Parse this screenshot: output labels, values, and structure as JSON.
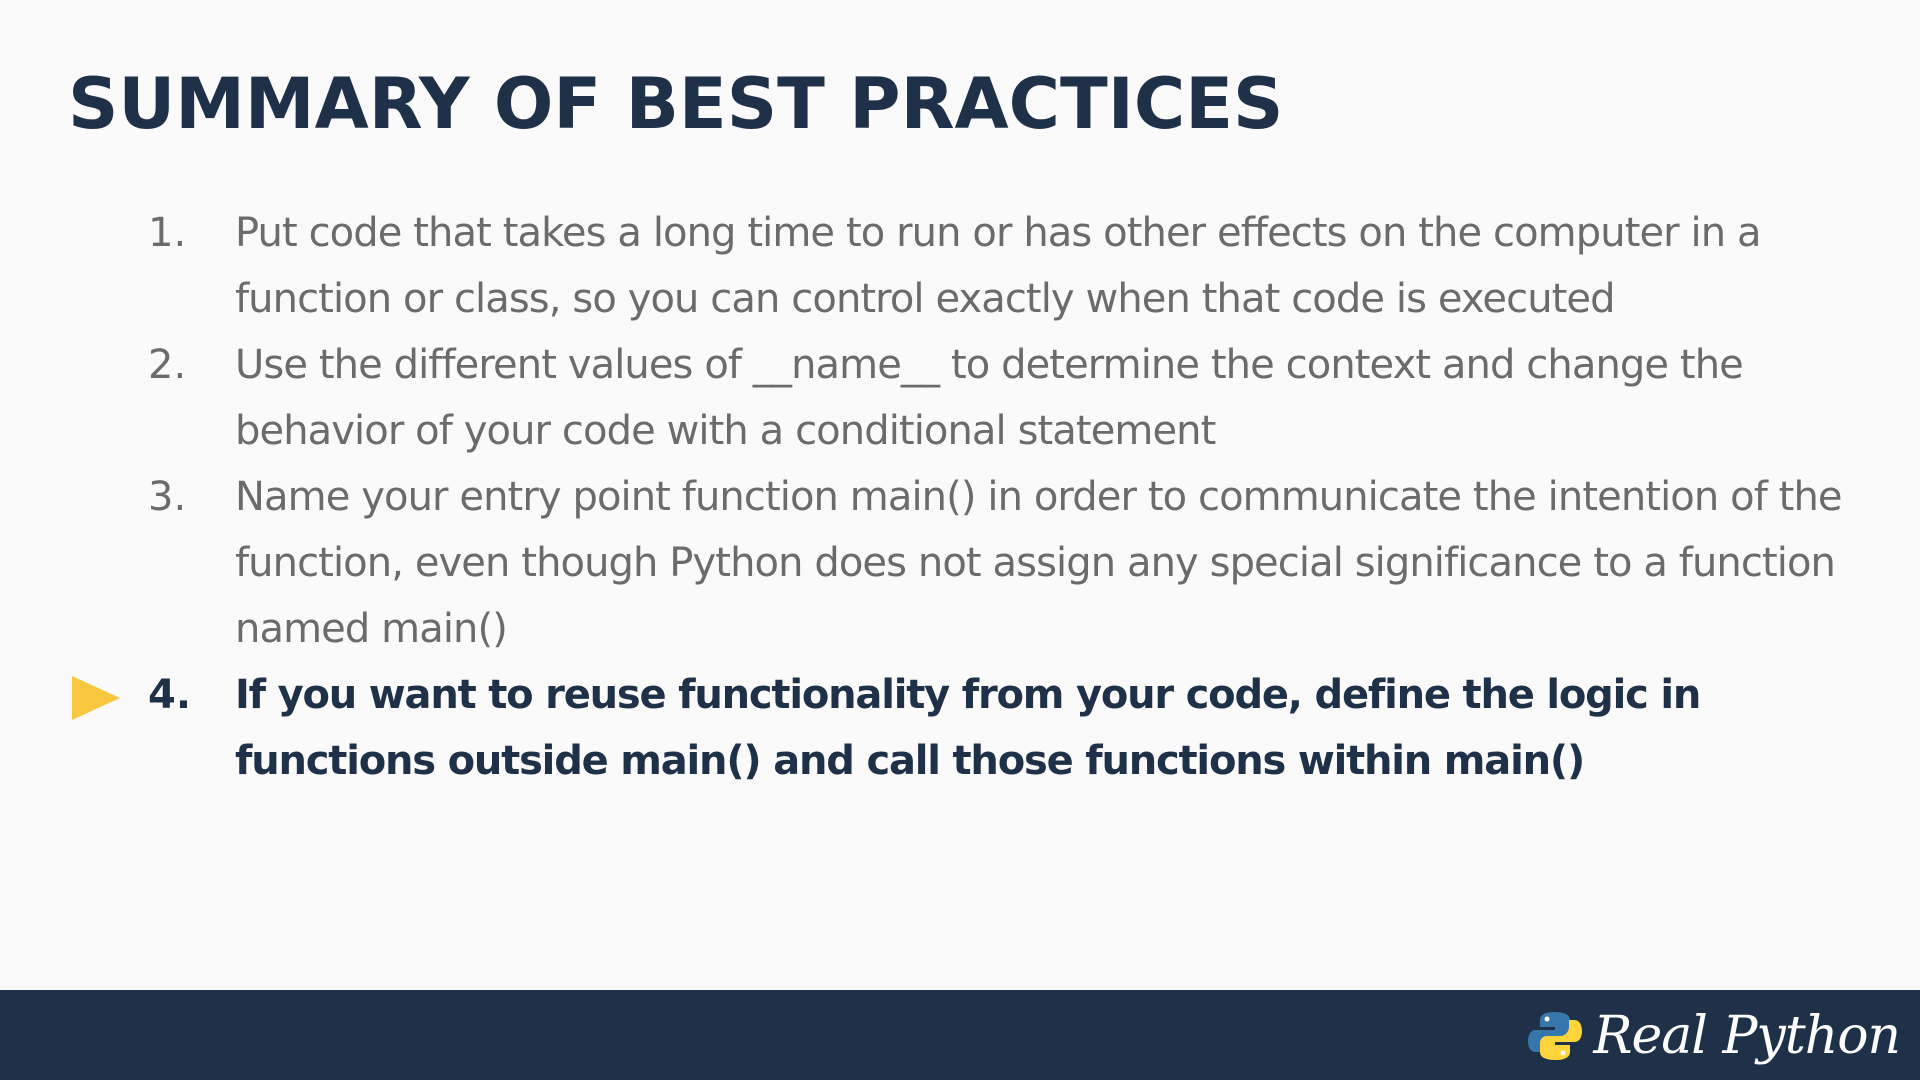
{
  "slide": {
    "title": "SUMMARY OF BEST PRACTICES",
    "items": [
      {
        "number": "1.",
        "text": "Put code that takes a long time to run or has other effects on the computer in a function or class, so you can control exactly when that code is executed"
      },
      {
        "number": "2.",
        "text": "Use the different values of __name__ to determine the context and change the behavior of your code with a conditional statement"
      },
      {
        "number": "3.",
        "text": "Name your entry point function main() in order to communicate the intention of the function, even though Python does not assign any special significance to a function named main()"
      },
      {
        "number": "4.",
        "text": "If you want to reuse functionality from your code, define the logic in functions outside main() and call those functions within main()",
        "active": true
      }
    ]
  },
  "footer": {
    "logo_text": "Real Python",
    "logo_icon": "python-logo-icon"
  },
  "colors": {
    "title": "#1f3149",
    "inactive_text": "#6b6b6b",
    "active_text": "#1f3149",
    "marker": "#f7c73f",
    "footer_bg": "#1f3149",
    "python_blue": "#3776ab",
    "python_yellow": "#ffd43b"
  }
}
